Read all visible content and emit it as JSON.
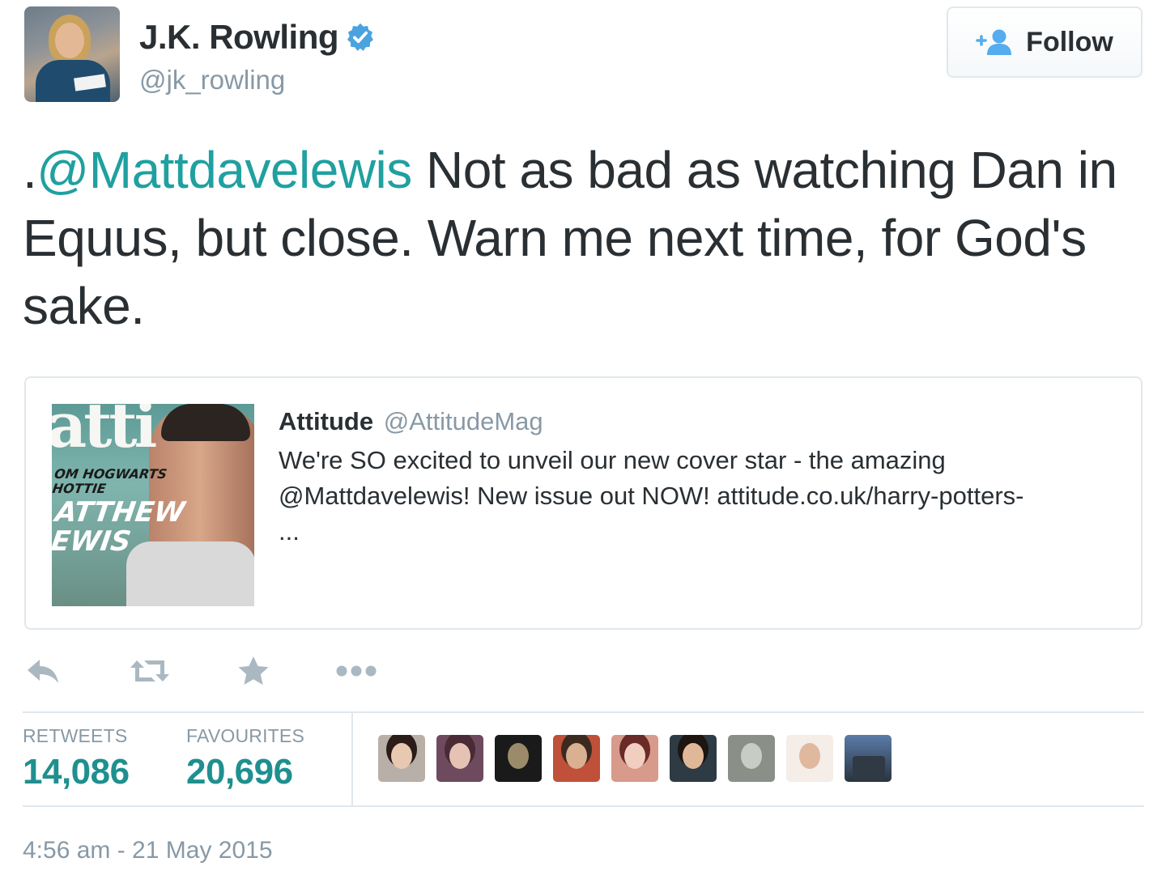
{
  "author": {
    "display_name": "J.K. Rowling",
    "handle": "@jk_rowling",
    "verified": true,
    "avatar_icon": "profile-photo"
  },
  "follow_button": {
    "label": "Follow",
    "icon": "add-user-icon"
  },
  "tweet": {
    "prefix": ".",
    "mention": "@Mattdavelewis",
    "text": " Not as bad as watching Dan in Equus, but close. Warn me next time, for God's sake."
  },
  "quoted_tweet": {
    "name": "Attitude",
    "handle": "@AttitudeMag",
    "text": "We're SO excited to unveil our new cover star - the amazing @Mattdavelewis! New issue out NOW! attitude.co.uk/harry-potters-",
    "ellipsis": "...",
    "thumbnail": {
      "masthead": "atti",
      "cover_line_1": "OM HOGWARTS",
      "cover_line_2": "HOTTIE",
      "cover_line_3": "ATTHEW",
      "cover_line_4": "EWIS"
    }
  },
  "actions": [
    {
      "name": "reply",
      "icon": "reply-icon"
    },
    {
      "name": "retweet",
      "icon": "retweet-icon"
    },
    {
      "name": "favourite",
      "icon": "star-icon"
    },
    {
      "name": "more",
      "icon": "more-icon"
    }
  ],
  "stats": {
    "retweets_label": "RETWEETS",
    "retweets_value": "14,086",
    "favourites_label": "FAVOURITES",
    "favourites_value": "20,696"
  },
  "favoriter_avatars": 9,
  "timestamp": "4:56 am - 21 May 2015",
  "colors": {
    "link": "#20a0a0",
    "text": "#292f33",
    "muted": "#8899a6",
    "verified": "#4aa3df",
    "border": "#e1e8ed",
    "stat_value": "#1f8f8f"
  }
}
